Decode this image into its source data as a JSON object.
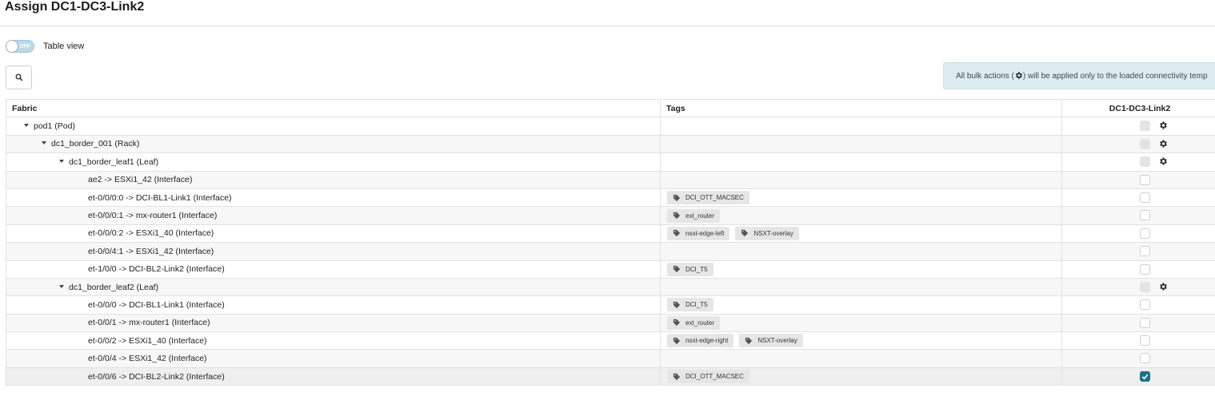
{
  "page": {
    "title": "Assign DC1-DC3-Link2"
  },
  "toolbar": {
    "toggle_state": "OFF",
    "toggle_label": "Table view"
  },
  "alert": {
    "text_before": "All bulk actions (",
    "text_after": ") will be applied only to the loaded connectivity temp"
  },
  "table": {
    "columns": {
      "fabric": "Fabric",
      "tags": "Tags",
      "template": "DC1-DC3-Link2"
    },
    "rows": [
      {
        "label": "pod1 (Pod)",
        "depth": 0,
        "expandable": true,
        "tags": [],
        "checkbox": "disabled",
        "gear": true
      },
      {
        "label": "dc1_border_001 (Rack)",
        "depth": 1,
        "expandable": true,
        "tags": [],
        "checkbox": "disabled",
        "gear": true
      },
      {
        "label": "dc1_border_leaf1 (Leaf)",
        "depth": 2,
        "expandable": true,
        "tags": [],
        "checkbox": "disabled",
        "gear": true
      },
      {
        "label": "ae2 -> ESXi1_42 (Interface)",
        "depth": 3,
        "expandable": false,
        "tags": [],
        "checkbox": "unchecked",
        "gear": false
      },
      {
        "label": "et-0/0/0:0 -> DCI-BL1-Link1 (Interface)",
        "depth": 3,
        "expandable": false,
        "tags": [
          "DCI_OTT_MACSEC"
        ],
        "checkbox": "unchecked",
        "gear": false
      },
      {
        "label": "et-0/0/0:1 -> mx-router1 (Interface)",
        "depth": 3,
        "expandable": false,
        "tags": [
          "ext_router"
        ],
        "checkbox": "unchecked",
        "gear": false
      },
      {
        "label": "et-0/0/0:2 -> ESXi1_40 (Interface)",
        "depth": 3,
        "expandable": false,
        "tags": [
          "nsxt-edge-left",
          "NSXT-overlay"
        ],
        "checkbox": "unchecked",
        "gear": false
      },
      {
        "label": "et-0/0/4:1 -> ESXi1_42 (Interface)",
        "depth": 3,
        "expandable": false,
        "tags": [],
        "checkbox": "unchecked",
        "gear": false
      },
      {
        "label": "et-1/0/0 -> DCI-BL2-Link2 (Interface)",
        "depth": 3,
        "expandable": false,
        "tags": [
          "DCI_T5"
        ],
        "checkbox": "unchecked",
        "gear": false
      },
      {
        "label": "dc1_border_leaf2 (Leaf)",
        "depth": 2,
        "expandable": true,
        "tags": [],
        "checkbox": "disabled",
        "gear": true
      },
      {
        "label": "et-0/0/0 -> DCI-BL1-Link1 (Interface)",
        "depth": 3,
        "expandable": false,
        "tags": [
          "DCI_T5"
        ],
        "checkbox": "unchecked",
        "gear": false
      },
      {
        "label": "et-0/0/1 -> mx-router1 (Interface)",
        "depth": 3,
        "expandable": false,
        "tags": [
          "ext_router"
        ],
        "checkbox": "unchecked",
        "gear": false
      },
      {
        "label": "et-0/0/2 -> ESXi1_40 (Interface)",
        "depth": 3,
        "expandable": false,
        "tags": [
          "nsxt-edge-right",
          "NSXT-overlay"
        ],
        "checkbox": "unchecked",
        "gear": false
      },
      {
        "label": "et-0/0/4 -> ESXi1_42 (Interface)",
        "depth": 3,
        "expandable": false,
        "tags": [],
        "checkbox": "unchecked",
        "gear": false
      },
      {
        "label": "et-0/0/6 -> DCI-BL2-Link2 (Interface)",
        "depth": 3,
        "expandable": false,
        "tags": [
          "DCI_OTT_MACSEC"
        ],
        "checkbox": "checked",
        "gear": false
      }
    ]
  },
  "icons": {
    "search": "search-icon",
    "gear": "gear-icon",
    "tag": "tag-icon",
    "caret": "caret-down-icon",
    "check": "check-icon"
  },
  "colors": {
    "accent": "#1b6f8a",
    "toggle_bg": "#b9d9e6",
    "alert_bg": "#dcecf1",
    "tag_bg": "#e6e6e6"
  }
}
